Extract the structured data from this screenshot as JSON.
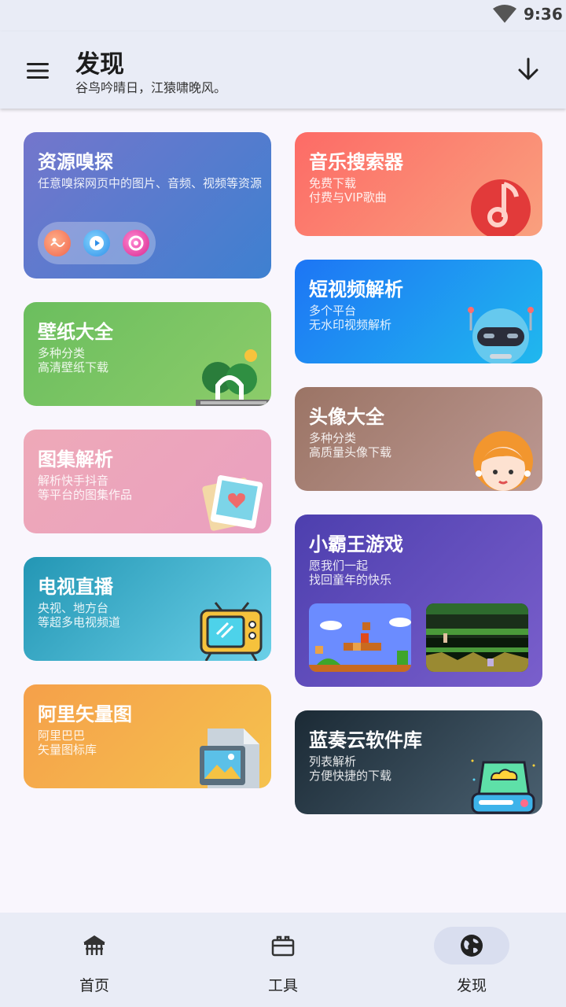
{
  "status": {
    "time": "9:36"
  },
  "appbar": {
    "title": "发现",
    "subtitle": "谷鸟吟晴日，江猿啸晚风。"
  },
  "cards": {
    "resource_sniff": {
      "title": "资源嗅探",
      "desc": "任意嗅探网页中的图片、音频、视频等资源"
    },
    "music_search": {
      "title": "音乐搜索器",
      "desc": "免费下载\n付费与VIP歌曲"
    },
    "wallpaper": {
      "title": "壁纸大全",
      "desc": "多种分类\n高清壁纸下载"
    },
    "short_video": {
      "title": "短视频解析",
      "desc": "多个平台\n无水印视频解析"
    },
    "gallery_parse": {
      "title": "图集解析",
      "desc": "解析快手抖音\n等平台的图集作品"
    },
    "avatar": {
      "title": "头像大全",
      "desc": "多种分类\n高质量头像下载"
    },
    "tv_live": {
      "title": "电视直播",
      "desc": "央视、地方台\n等超多电视频道"
    },
    "retro_games": {
      "title": "小霸王游戏",
      "desc": "愿我们一起\n找回童年的快乐"
    },
    "ali_vector": {
      "title": "阿里矢量图",
      "desc": "阿里巴巴\n矢量图标库"
    },
    "lanzou": {
      "title": "蓝奏云软件库",
      "desc": "列表解析\n方便快捷的下载"
    }
  },
  "bottom_nav": {
    "items": [
      {
        "label": "首页",
        "icon": "home-icon"
      },
      {
        "label": "工具",
        "icon": "toolbox-icon"
      },
      {
        "label": "发现",
        "icon": "globe-icon",
        "selected": true
      }
    ]
  }
}
